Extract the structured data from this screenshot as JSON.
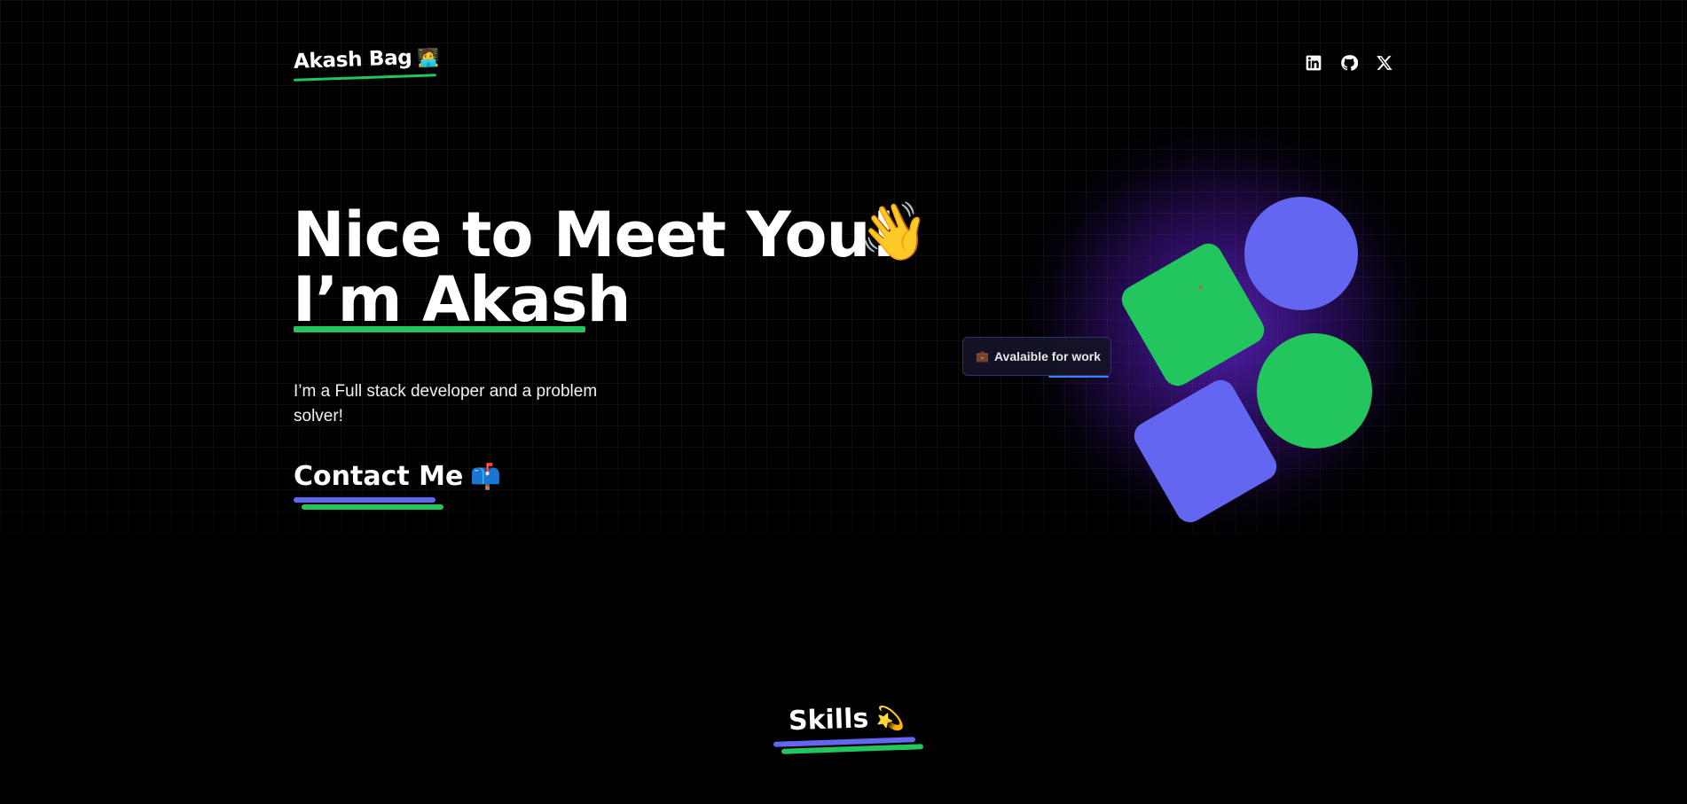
{
  "header": {
    "brand_name": "Akash Bag",
    "brand_emoji": "🧑‍💻",
    "socials": [
      {
        "name": "linkedin-icon"
      },
      {
        "name": "github-icon"
      },
      {
        "name": "x-icon"
      }
    ]
  },
  "hero": {
    "line1": "Nice to Meet You!",
    "wave_emoji": "👋",
    "line2": "I’m Akash",
    "bio": "I’m a Full stack developer and a problem solver!",
    "contact_label": "Contact Me",
    "contact_emoji": "📫"
  },
  "badge": {
    "emoji": "💼",
    "label": "Avalaible for work"
  },
  "skills": {
    "title": "Skills",
    "emoji": "💫"
  },
  "colors": {
    "background": "#000000",
    "green": "#22c55e",
    "indigo": "#6366f1",
    "glow": "#6e28e6"
  }
}
